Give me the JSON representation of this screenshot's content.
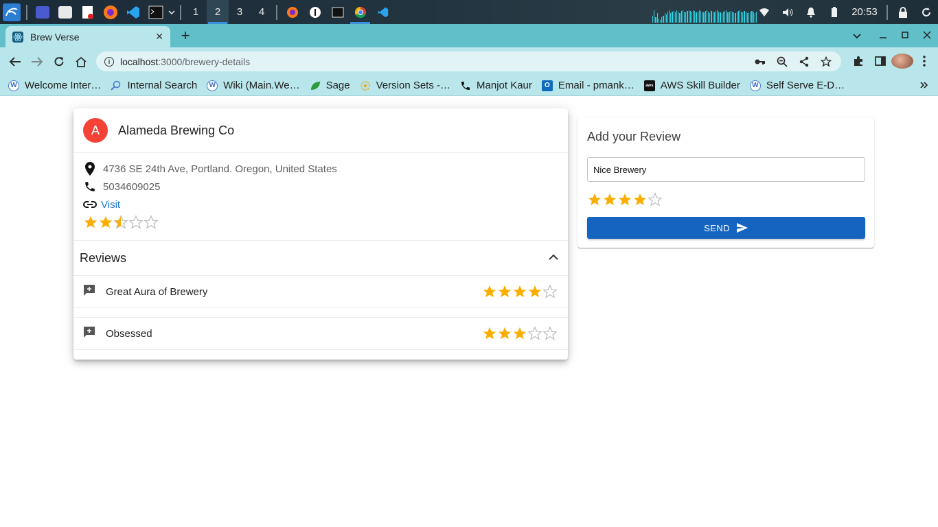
{
  "taskbar": {
    "workspaces": [
      "1",
      "2",
      "3",
      "4"
    ],
    "active_workspace": "2",
    "clock": "20:53"
  },
  "browser": {
    "tab_title": "Brew Verse",
    "url_host": "localhost",
    "url_rest": ":3000/brewery-details",
    "bookmarks": [
      {
        "label": "Welcome Inter…",
        "icon": "w-icon"
      },
      {
        "label": "Internal Search",
        "icon": "search-icon"
      },
      {
        "label": "Wiki (Main.We…",
        "icon": "w-icon"
      },
      {
        "label": "Sage",
        "icon": "leaf-icon"
      },
      {
        "label": "Version Sets -…",
        "icon": "gear-icon"
      },
      {
        "label": "Manjot Kaur",
        "icon": "phone-icon"
      },
      {
        "label": "Email - pmank…",
        "icon": "outlook-icon"
      },
      {
        "label": "AWS Skill Builder",
        "icon": "aws-icon"
      },
      {
        "label": "Self Serve E-D…",
        "icon": "w-icon"
      }
    ]
  },
  "brewery": {
    "avatar_letter": "A",
    "name": "Alameda Brewing Co",
    "address": "4736 SE 24th Ave, Portland. Oregon, United States",
    "phone": "5034609025",
    "visit_label": "Visit",
    "rating": 2.5,
    "rating_max": 5
  },
  "reviews": {
    "title": "Reviews",
    "items": [
      {
        "text": "Great Aura of Brewery",
        "rating": 4
      },
      {
        "text": "Obsessed",
        "rating": 3
      }
    ]
  },
  "add_review": {
    "title": "Add your Review",
    "input_value": "Nice Brewery",
    "rating": 4,
    "send_label": "SEND"
  },
  "colors": {
    "star": "#faaf00",
    "star_empty": "#bdbdbd",
    "avatar_bg": "#f44336",
    "send_button": "#1565c0",
    "link": "#1976d2",
    "tabstrip": "#60bfc8",
    "toolbar": "#b9e6eb"
  }
}
